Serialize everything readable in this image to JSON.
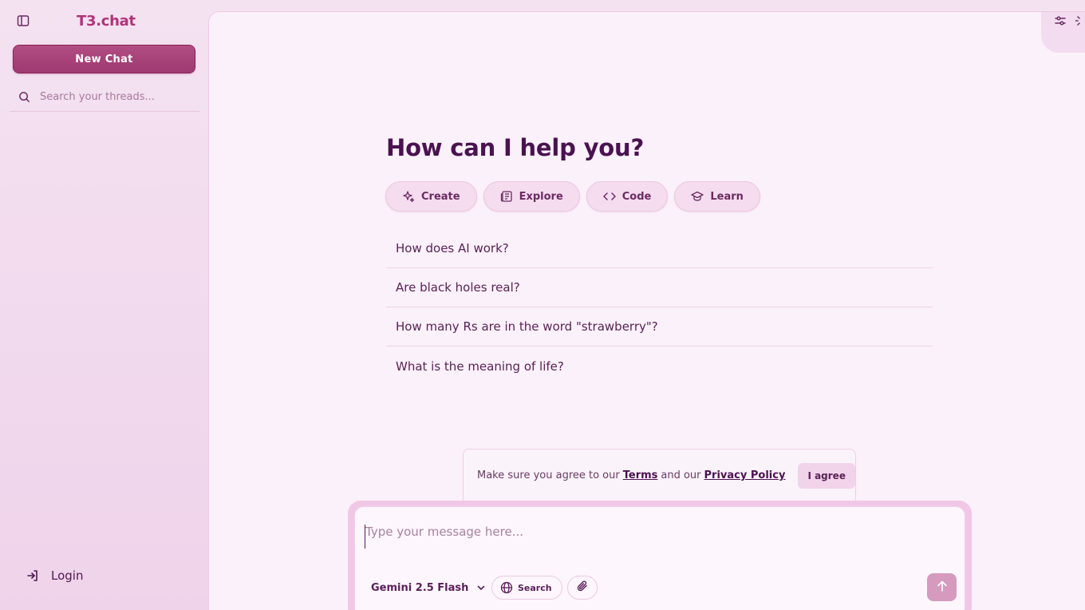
{
  "sidebar": {
    "brand": "T3.chat",
    "new_chat_label": "New Chat",
    "search_placeholder": "Search your threads...",
    "login_label": "Login"
  },
  "main": {
    "title": "How can I help you?",
    "chips": [
      {
        "label": "Create",
        "icon": "sparkles-icon"
      },
      {
        "label": "Explore",
        "icon": "newspaper-icon"
      },
      {
        "label": "Code",
        "icon": "code-icon"
      },
      {
        "label": "Learn",
        "icon": "graduation-cap-icon"
      }
    ],
    "suggestions": [
      "How does AI work?",
      "Are black holes real?",
      "How many Rs are in the word \"strawberry\"?",
      "What is the meaning of life?"
    ]
  },
  "terms": {
    "prefix": "Make sure you agree to our",
    "terms_link": "Terms",
    "middle": "and our",
    "privacy_link": "Privacy Policy",
    "agree_label": "I agree"
  },
  "composer": {
    "placeholder": "Type your message here...",
    "model": "Gemini 2.5 Flash",
    "search_label": "Search"
  },
  "colors": {
    "accent": "#b0337a",
    "button": "#a03a72",
    "text": "#501854",
    "send_disabled": "#d59abe"
  }
}
